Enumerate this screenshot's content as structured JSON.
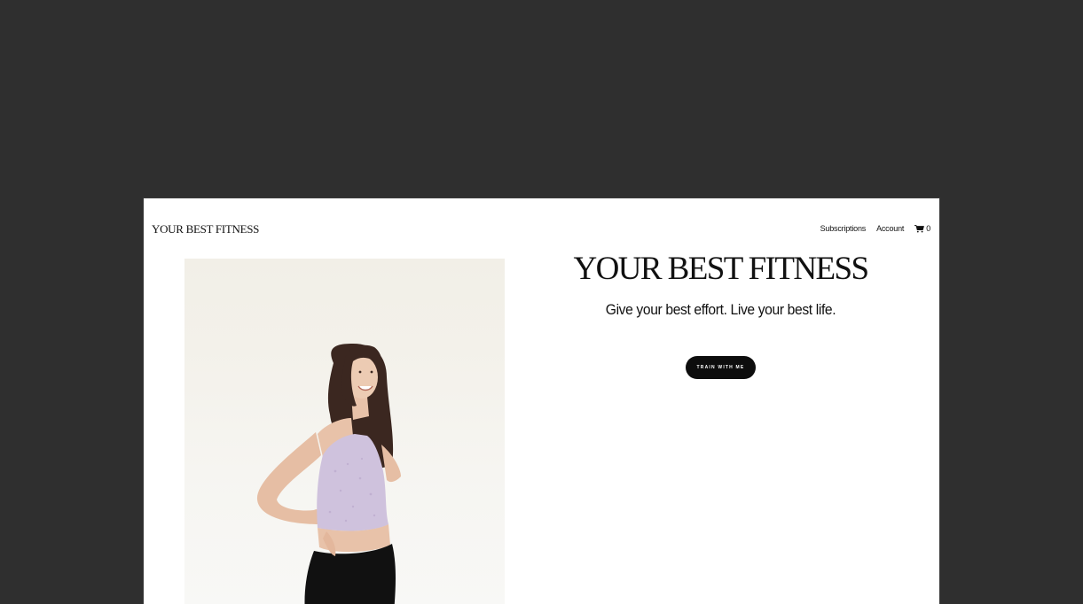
{
  "header": {
    "logo_text": "YOUR BEST FITNESS",
    "nav": {
      "subscriptions": "Subscriptions",
      "account": "Account",
      "cart_count": "0",
      "cart_icon": "cart-icon"
    }
  },
  "hero": {
    "title": "YOUR BEST FITNESS",
    "subtitle": "Give your best effort. Live your best life.",
    "cta_label": "TRAIN WITH ME"
  },
  "colors": {
    "backdrop": "#2f2f2f",
    "page_background": "#ffffff",
    "text": "#111111",
    "button_background": "#0d0d0d",
    "button_text": "#ffffff",
    "top_color": "#cfc2dd",
    "leggings_color": "#111111",
    "hair_color": "#3b2720"
  }
}
